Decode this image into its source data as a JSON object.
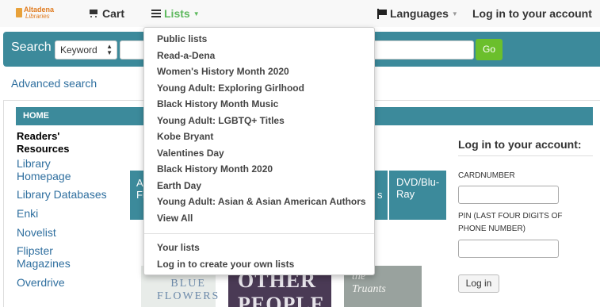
{
  "navbar": {
    "logo_line1": "Altadena",
    "logo_line2": "Libraries",
    "cart": "Cart",
    "lists": "Lists",
    "languages": "Languages",
    "login": "Log in to your account"
  },
  "search": {
    "label": "Search",
    "type_selected": "Keyword",
    "query": "",
    "go_label": "Go"
  },
  "advanced_search": "Advanced search",
  "breadcrumb": "HOME",
  "sidebar": {
    "heading": "Readers' Resources",
    "links": [
      "Library Homepage",
      "Library Databases",
      "Enki",
      "Novelist",
      "Flipster Magazines",
      "Overdrive"
    ]
  },
  "tiles": {
    "left_text": "A\nFi",
    "right_text": "s",
    "dvd": "DVD/Blu-\nRay"
  },
  "books": {
    "book1_text": "BLUE\nFLOWERS",
    "book2_text": "OTHER\nPEOPLE",
    "book3_text": "the\nTruants"
  },
  "login_panel": {
    "title": "Log in to your account:",
    "cardnumber_label": "CARDNUMBER",
    "pin_label": "PIN (LAST FOUR DIGITS OF PHONE NUMBER)",
    "button": "Log in"
  },
  "lists_menu": {
    "public_header": "Public lists",
    "public_lists": [
      "Read-a-Dena",
      "Women's History Month 2020",
      "Young Adult: Exploring Girlhood",
      "Black History Month Music",
      "Young Adult: LGBTQ+ Titles",
      "Kobe Bryant",
      "Valentines Day",
      "Black History Month 2020",
      "Earth Day",
      "Young Adult: Asian & Asian American Authors",
      "View All"
    ],
    "your_lists": "Your lists",
    "login_create": "Log in to create your own lists"
  },
  "colors": {
    "accent_teal": "#3c8a9b",
    "go_green": "#6bbf2c",
    "lists_green": "#5cb85c",
    "link_blue": "#2f6f9f"
  },
  "icons": {
    "cart": "shopping-cart-icon",
    "lists": "list-icon",
    "languages": "flag-icon"
  }
}
